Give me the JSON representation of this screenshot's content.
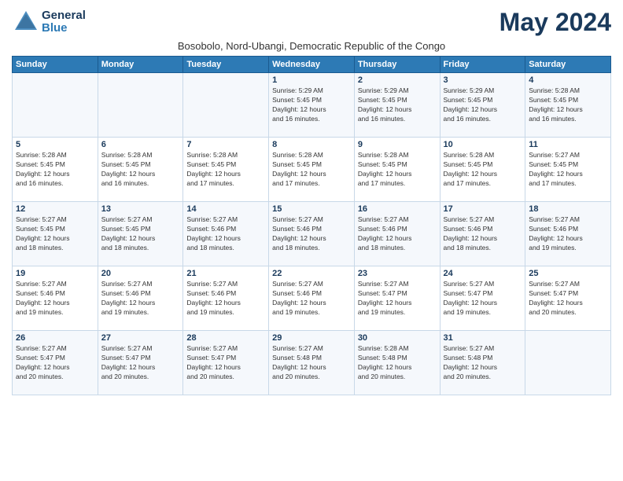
{
  "header": {
    "logo_general": "General",
    "logo_blue": "Blue",
    "month_title": "May 2024",
    "subtitle": "Bosobolo, Nord-Ubangi, Democratic Republic of the Congo"
  },
  "weekdays": [
    "Sunday",
    "Monday",
    "Tuesday",
    "Wednesday",
    "Thursday",
    "Friday",
    "Saturday"
  ],
  "weeks": [
    {
      "cells": [
        {
          "day": "",
          "info": ""
        },
        {
          "day": "",
          "info": ""
        },
        {
          "day": "",
          "info": ""
        },
        {
          "day": "1",
          "info": "Sunrise: 5:29 AM\nSunset: 5:45 PM\nDaylight: 12 hours\nand 16 minutes."
        },
        {
          "day": "2",
          "info": "Sunrise: 5:29 AM\nSunset: 5:45 PM\nDaylight: 12 hours\nand 16 minutes."
        },
        {
          "day": "3",
          "info": "Sunrise: 5:29 AM\nSunset: 5:45 PM\nDaylight: 12 hours\nand 16 minutes."
        },
        {
          "day": "4",
          "info": "Sunrise: 5:28 AM\nSunset: 5:45 PM\nDaylight: 12 hours\nand 16 minutes."
        }
      ]
    },
    {
      "cells": [
        {
          "day": "5",
          "info": "Sunrise: 5:28 AM\nSunset: 5:45 PM\nDaylight: 12 hours\nand 16 minutes."
        },
        {
          "day": "6",
          "info": "Sunrise: 5:28 AM\nSunset: 5:45 PM\nDaylight: 12 hours\nand 16 minutes."
        },
        {
          "day": "7",
          "info": "Sunrise: 5:28 AM\nSunset: 5:45 PM\nDaylight: 12 hours\nand 17 minutes."
        },
        {
          "day": "8",
          "info": "Sunrise: 5:28 AM\nSunset: 5:45 PM\nDaylight: 12 hours\nand 17 minutes."
        },
        {
          "day": "9",
          "info": "Sunrise: 5:28 AM\nSunset: 5:45 PM\nDaylight: 12 hours\nand 17 minutes."
        },
        {
          "day": "10",
          "info": "Sunrise: 5:28 AM\nSunset: 5:45 PM\nDaylight: 12 hours\nand 17 minutes."
        },
        {
          "day": "11",
          "info": "Sunrise: 5:27 AM\nSunset: 5:45 PM\nDaylight: 12 hours\nand 17 minutes."
        }
      ]
    },
    {
      "cells": [
        {
          "day": "12",
          "info": "Sunrise: 5:27 AM\nSunset: 5:45 PM\nDaylight: 12 hours\nand 18 minutes."
        },
        {
          "day": "13",
          "info": "Sunrise: 5:27 AM\nSunset: 5:45 PM\nDaylight: 12 hours\nand 18 minutes."
        },
        {
          "day": "14",
          "info": "Sunrise: 5:27 AM\nSunset: 5:46 PM\nDaylight: 12 hours\nand 18 minutes."
        },
        {
          "day": "15",
          "info": "Sunrise: 5:27 AM\nSunset: 5:46 PM\nDaylight: 12 hours\nand 18 minutes."
        },
        {
          "day": "16",
          "info": "Sunrise: 5:27 AM\nSunset: 5:46 PM\nDaylight: 12 hours\nand 18 minutes."
        },
        {
          "day": "17",
          "info": "Sunrise: 5:27 AM\nSunset: 5:46 PM\nDaylight: 12 hours\nand 18 minutes."
        },
        {
          "day": "18",
          "info": "Sunrise: 5:27 AM\nSunset: 5:46 PM\nDaylight: 12 hours\nand 19 minutes."
        }
      ]
    },
    {
      "cells": [
        {
          "day": "19",
          "info": "Sunrise: 5:27 AM\nSunset: 5:46 PM\nDaylight: 12 hours\nand 19 minutes."
        },
        {
          "day": "20",
          "info": "Sunrise: 5:27 AM\nSunset: 5:46 PM\nDaylight: 12 hours\nand 19 minutes."
        },
        {
          "day": "21",
          "info": "Sunrise: 5:27 AM\nSunset: 5:46 PM\nDaylight: 12 hours\nand 19 minutes."
        },
        {
          "day": "22",
          "info": "Sunrise: 5:27 AM\nSunset: 5:46 PM\nDaylight: 12 hours\nand 19 minutes."
        },
        {
          "day": "23",
          "info": "Sunrise: 5:27 AM\nSunset: 5:47 PM\nDaylight: 12 hours\nand 19 minutes."
        },
        {
          "day": "24",
          "info": "Sunrise: 5:27 AM\nSunset: 5:47 PM\nDaylight: 12 hours\nand 19 minutes."
        },
        {
          "day": "25",
          "info": "Sunrise: 5:27 AM\nSunset: 5:47 PM\nDaylight: 12 hours\nand 20 minutes."
        }
      ]
    },
    {
      "cells": [
        {
          "day": "26",
          "info": "Sunrise: 5:27 AM\nSunset: 5:47 PM\nDaylight: 12 hours\nand 20 minutes."
        },
        {
          "day": "27",
          "info": "Sunrise: 5:27 AM\nSunset: 5:47 PM\nDaylight: 12 hours\nand 20 minutes."
        },
        {
          "day": "28",
          "info": "Sunrise: 5:27 AM\nSunset: 5:47 PM\nDaylight: 12 hours\nand 20 minutes."
        },
        {
          "day": "29",
          "info": "Sunrise: 5:27 AM\nSunset: 5:48 PM\nDaylight: 12 hours\nand 20 minutes."
        },
        {
          "day": "30",
          "info": "Sunrise: 5:28 AM\nSunset: 5:48 PM\nDaylight: 12 hours\nand 20 minutes."
        },
        {
          "day": "31",
          "info": "Sunrise: 5:27 AM\nSunset: 5:48 PM\nDaylight: 12 hours\nand 20 minutes."
        },
        {
          "day": "",
          "info": ""
        }
      ]
    }
  ]
}
